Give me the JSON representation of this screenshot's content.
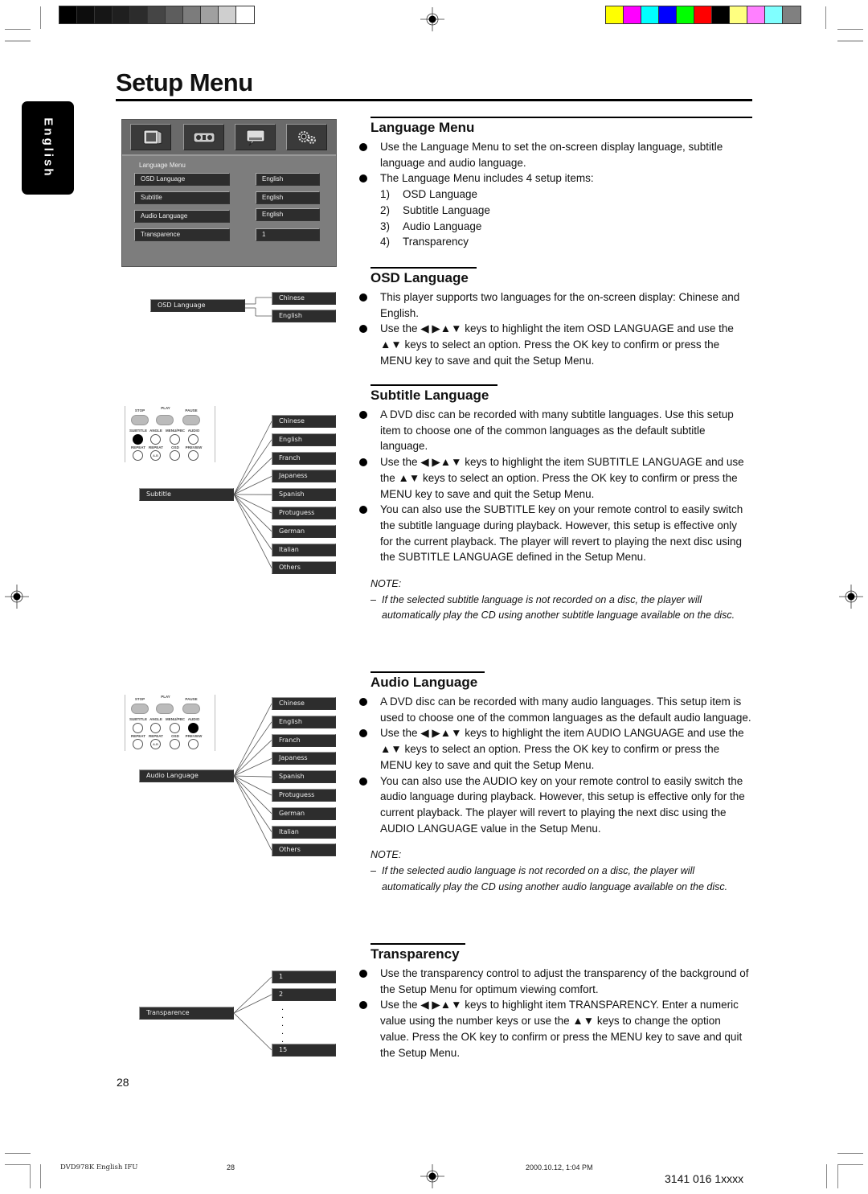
{
  "print_marks": {
    "grayscale_swatches": [
      "#000000",
      "#0d0d0d",
      "#161616",
      "#1f1f1f",
      "#2c2c2c",
      "#454545",
      "#5d5d5d",
      "#7c7c7c",
      "#a0a0a0",
      "#cfcfcf",
      "#ffffff"
    ],
    "color_swatches": [
      "#ffff00",
      "#ff00ff",
      "#00ffff",
      "#0000ff",
      "#00ff00",
      "#ff0000",
      "#000000",
      "#ffff80",
      "#ff80ff",
      "#80ffff",
      "#808080"
    ]
  },
  "header": {
    "title": "Setup Menu",
    "language_tab": "English"
  },
  "osd_screen": {
    "icons": [
      "tv-icon",
      "speaker-icon",
      "speech-bubble-icon",
      "gears-icon"
    ],
    "caption": "Language Menu",
    "rows": [
      {
        "label": "OSD Language",
        "value": "English"
      },
      {
        "label": "Subtitle",
        "value": "English"
      },
      {
        "label": "Audio Language",
        "value": "English"
      },
      {
        "label": "Transparence",
        "value": "1"
      }
    ]
  },
  "diagrams": {
    "osd": {
      "source": "OSD Language",
      "options": [
        "Chinese",
        "English"
      ]
    },
    "subtitle": {
      "source": "Subtitle",
      "options": [
        "Chinese",
        "English",
        "Franch",
        "Japaness",
        "Spanish",
        "Protuguess",
        "German",
        "Italian",
        "Others"
      ]
    },
    "audio": {
      "source": "Audio Language",
      "options": [
        "Chinese",
        "English",
        "Franch",
        "Japaness",
        "Spanish",
        "Protuguess",
        "German",
        "Italian",
        "Others"
      ]
    },
    "transparency": {
      "source": "Transparence",
      "options": [
        "1",
        "2",
        "15"
      ],
      "ellipsis": ".\n.\n.\n.\n."
    }
  },
  "remote": {
    "labels": {
      "stop": "STOP",
      "play": "PLAY",
      "pause": "PAUSE",
      "subtitle": "SUBTITLE",
      "angle": "ANGLE",
      "menu_pbc": "MENU/PBC",
      "audio": "AUDIO",
      "repeat": "REPEAT",
      "repeat_ab": "REPEAT",
      "osd": "OSD",
      "preview": "PREVIEW",
      "ab": "A-B"
    }
  },
  "sections": {
    "language_menu": {
      "title": "Language Menu",
      "bullets": [
        "Use the Language Menu to set the on-screen display language, subtitle language and audio language.",
        "The Language Menu includes 4 setup items:"
      ],
      "items": [
        {
          "n": "1)",
          "label": "OSD Language"
        },
        {
          "n": "2)",
          "label": "Subtitle Language"
        },
        {
          "n": "3)",
          "label": "Audio Language"
        },
        {
          "n": "4)",
          "label": "Transparency"
        }
      ]
    },
    "osd_language": {
      "title": "OSD Language",
      "bullets": [
        "This player supports two languages for the on-screen display: Chinese and English.",
        "Use the ◀ ▶▲▼ keys to highlight the item OSD LANGUAGE and use the ▲▼ keys to select an option. Press the OK key to confirm or press the MENU key to save and quit the Setup Menu."
      ]
    },
    "subtitle_language": {
      "title": "Subtitle Language",
      "bullets": [
        "A DVD disc can be recorded with many subtitle languages.  Use this setup item to choose one of the common languages as the default subtitle language.",
        "Use the ◀ ▶▲▼ keys to highlight the item SUBTITLE LANGUAGE and use the ▲▼ keys to select an option. Press the OK key to confirm or press the MENU key to save and quit the Setup Menu.",
        "You can also use the SUBTITLE key on your remote control to easily switch the subtitle language during playback.  However, this setup is effective only for the current playback. The player will revert to playing the next disc using the SUBTITLE LANGUAGE defined in the Setup Menu."
      ],
      "note_label": "NOTE:",
      "note": "If the selected subtitle language is not recorded on a disc, the player will automatically play the CD using another subtitle language available on the disc."
    },
    "audio_language": {
      "title": "Audio Language",
      "bullets": [
        "A DVD disc can be recorded with many audio languages. This setup item is used to choose one of the common languages as the default audio language.",
        "Use the ◀ ▶▲▼ keys to highlight the item AUDIO LANGUAGE and use the ▲▼ keys to select an option. Press the OK key to confirm or press the MENU key to save and quit the Setup Menu.",
        "You can also use the AUDIO key on your remote control to easily switch the audio language during playback. However, this setup is effective only for the current playback. The player will revert to playing the next disc using the AUDIO LANGUAGE value in the Setup Menu."
      ],
      "note_label": "NOTE:",
      "note": "If the selected audio language is not recorded on a disc, the player will automatically play the CD using another audio language available on the disc."
    },
    "transparency": {
      "title": "Transparency",
      "bullets": [
        "Use the transparency control to adjust the transparency of the background of the Setup Menu for optimum viewing comfort.",
        "Use the ◀ ▶▲▼ keys to highlight item TRANSPARENCY.  Enter a numeric value using the number keys or use the ▲▼ keys to change the option value.  Press the OK key to confirm or press the MENU key to save and quit the Setup Menu."
      ]
    }
  },
  "footer": {
    "page_number": "28",
    "file_name": "DVD978K English IFU",
    "file_page": "28",
    "timestamp": "2000.10.12, 1:04 PM",
    "part_number": "3141 016 1xxxx"
  }
}
